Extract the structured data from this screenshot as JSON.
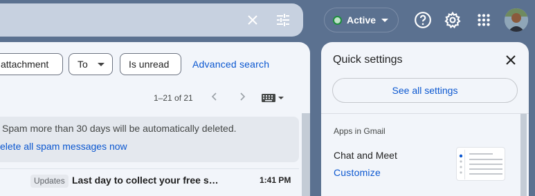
{
  "topbar": {
    "clear_icon": "close-icon",
    "tune_icon": "tune-icon",
    "status_label": "Active",
    "status_color": "#1e8e3e",
    "help_icon": "help-icon",
    "settings_icon": "gear-icon",
    "apps_icon": "apps-grid-icon"
  },
  "filters": {
    "chips": [
      "attachment",
      "To",
      "Is unread"
    ],
    "advanced_search": "Advanced search"
  },
  "pagination": {
    "range": "1–21 of 21"
  },
  "spam_banner": {
    "notice": "Spam more than 30 days will be automatically deleted.",
    "action": "elete all spam messages now"
  },
  "messages": [
    {
      "label": "Updates",
      "subject": "Last day to collect your free s…",
      "time": "1:41 PM"
    }
  ],
  "quick_settings": {
    "title": "Quick settings",
    "see_all": "See all settings",
    "apps_heading": "Apps in Gmail",
    "chat_meet": "Chat and Meet",
    "customize": "Customize"
  },
  "colors": {
    "background": "#5b7190",
    "link": "#0b57d0"
  }
}
